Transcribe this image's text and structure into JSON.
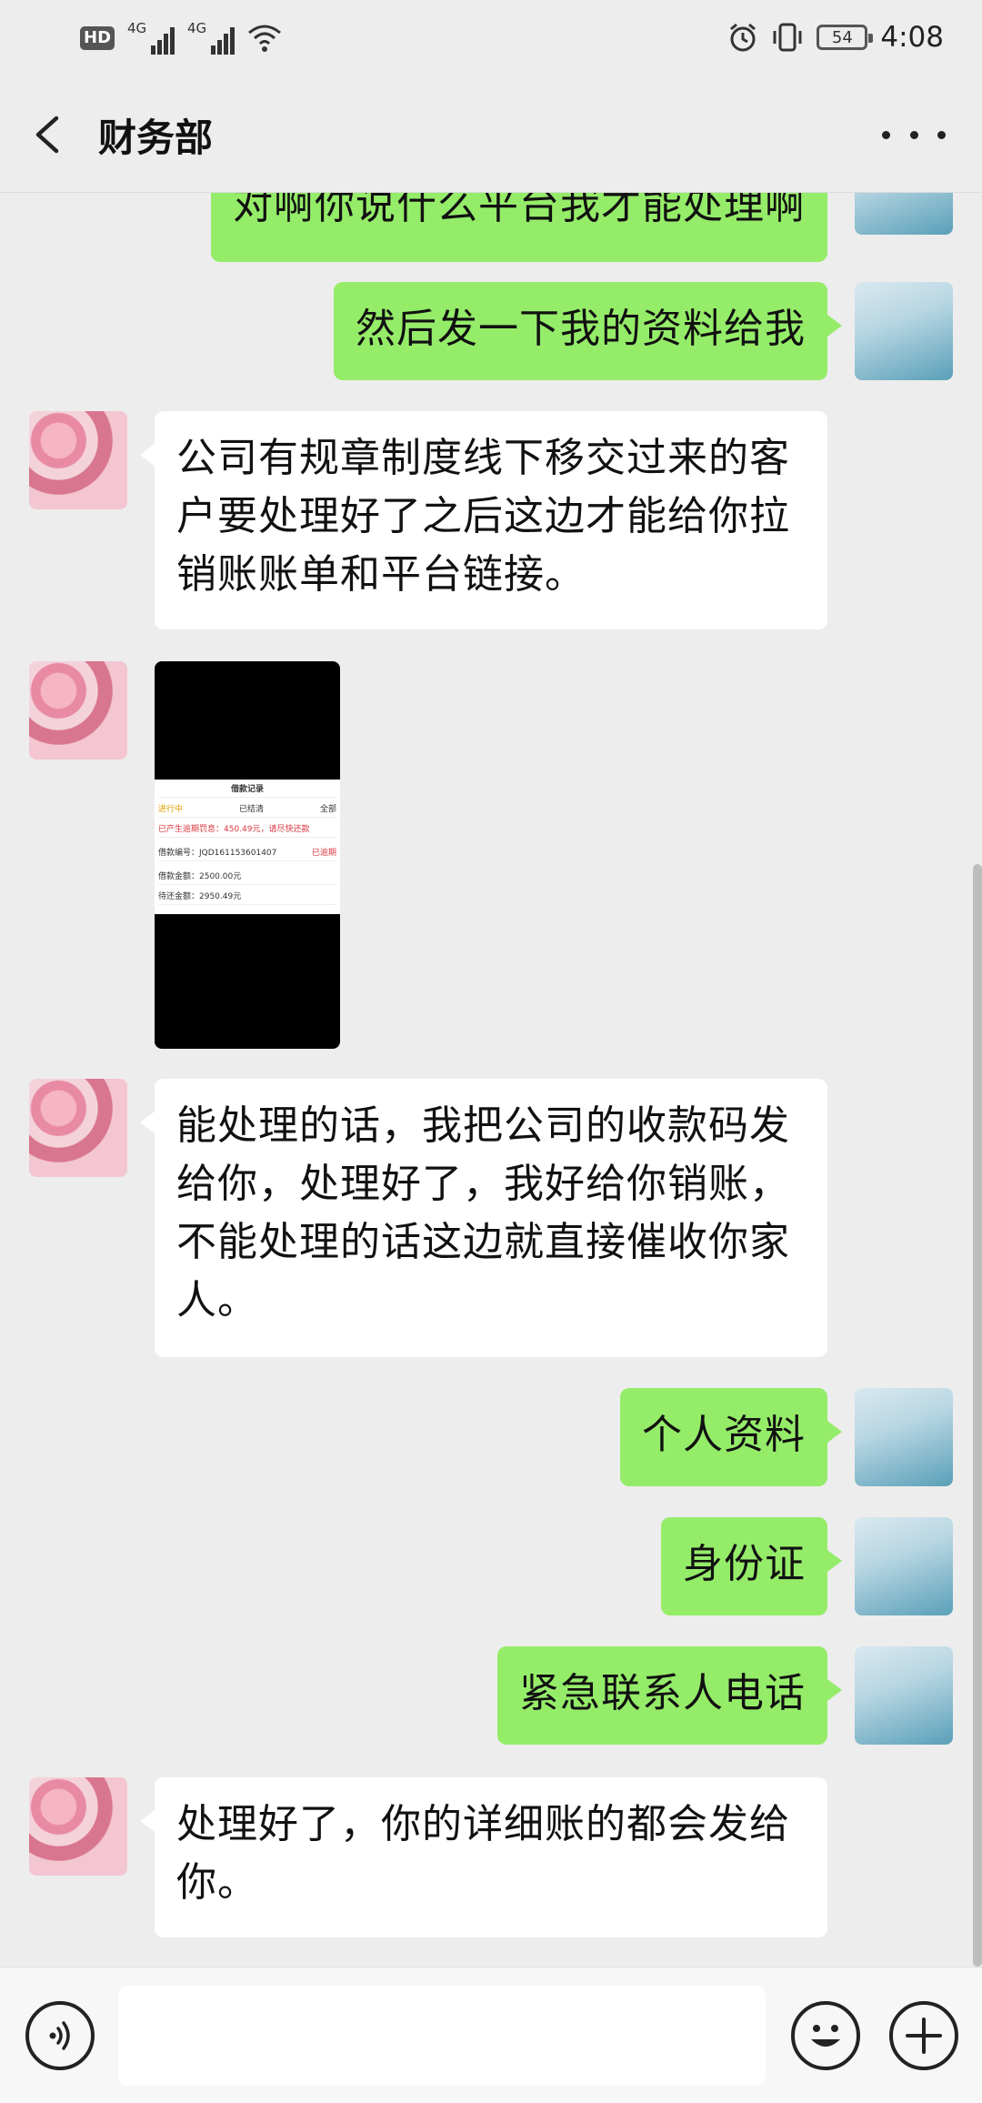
{
  "status_bar": {
    "hd": "HD",
    "net1": "4G",
    "net2": "4G",
    "battery": "54",
    "time": "4:08"
  },
  "header": {
    "title": "财务部"
  },
  "messages": [
    {
      "from": "me",
      "text": "对啊你说什么平台我才能处理啊"
    },
    {
      "from": "me",
      "text": "然后发一下我的资料给我"
    },
    {
      "from": "other",
      "text": "公司有规章制度线下移交过来的客户要处理好了之后这边才能给你拉销账账单和平台链接。"
    },
    {
      "from": "other",
      "type": "image"
    },
    {
      "from": "other",
      "text": "能处理的话，我把公司的收款码发给你，处理好了，我好给你销账，不能处理的话这边就直接催收你家人。"
    },
    {
      "from": "me",
      "text": "个人资料"
    },
    {
      "from": "me",
      "text": "身份证"
    },
    {
      "from": "me",
      "text": "紧急联系人电话"
    },
    {
      "from": "other",
      "text": "处理好了，你的详细账的都会发给你。"
    }
  ],
  "image_message": {
    "title": "借款记录",
    "tabs": [
      "进行中",
      "已结清",
      "全部"
    ],
    "warning": "已产生逾期罚息：450.49元，请尽快还款",
    "loan_no_label": "借款编号：JQD1611536014​07",
    "overdue": "已逾期",
    "amount": "借款金额：2500.00元",
    "due": "待还金额：2950.49元"
  },
  "input_bar": {
    "placeholder": ""
  }
}
